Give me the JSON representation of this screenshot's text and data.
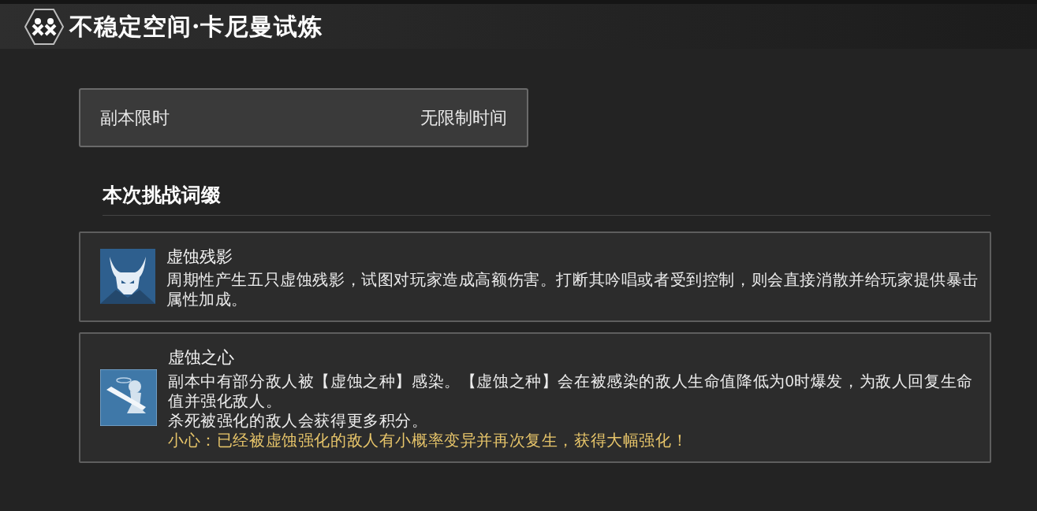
{
  "header": {
    "title": "不稳定空间·卡尼曼试炼"
  },
  "time_limit": {
    "label": "副本限时",
    "value": "无限制时间"
  },
  "section_title": "本次挑战词缀",
  "affixes": [
    {
      "name": "虚蚀残影",
      "paragraphs": [
        {
          "kind": "normal",
          "text": "周期性产生五只虚蚀残影，试图对玩家造成高额伤害。打断其吟唱或者受到控制，则会直接消散并给玩家提供暴击属性加成。"
        }
      ]
    },
    {
      "name": "虚蚀之心",
      "paragraphs": [
        {
          "kind": "normal",
          "text": "副本中有部分敌人被【虚蚀之种】感染。【虚蚀之种】会在被感染的敌人生命值降低为0时爆发，为敌人回复生命值并强化敌人。"
        },
        {
          "kind": "normal",
          "text": "杀死被强化的敌人会获得更多积分。"
        },
        {
          "kind": "warning",
          "text": "小心：已经被虚蚀强化的敌人有小概率变异并再次复生，获得大幅强化！"
        }
      ]
    }
  ]
}
